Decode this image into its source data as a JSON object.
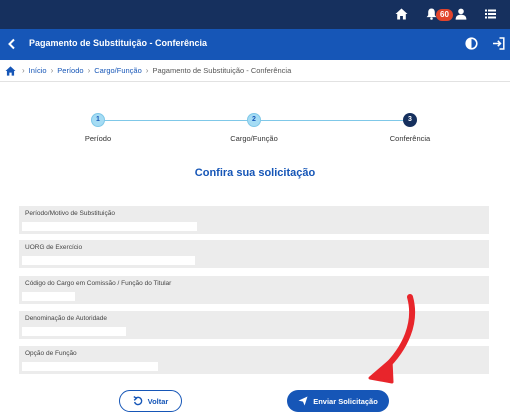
{
  "topbar": {
    "notifications_count": "60",
    "icons": [
      "home-icon",
      "bell-icon",
      "user-icon",
      "menu-icon"
    ]
  },
  "titlebar": {
    "title": "Pagamento de Substituição - Conferência"
  },
  "breadcrumb": {
    "items": [
      "Início",
      "Período",
      "Cargo/Função",
      "Pagamento de Substituição - Conferência"
    ]
  },
  "stepper": {
    "steps": [
      {
        "number": "1",
        "label": "Período",
        "state": "pending"
      },
      {
        "number": "2",
        "label": "Cargo/Função",
        "state": "pending"
      },
      {
        "number": "3",
        "label": "Conferência",
        "state": "active"
      }
    ]
  },
  "main": {
    "heading": "Confira sua solicitação",
    "fields": [
      {
        "label": "Período/Motivo de Substituição"
      },
      {
        "label": "UORG de Exercício"
      },
      {
        "label": "Código do Cargo em Comissão / Função do Titular"
      },
      {
        "label": "Denominação de Autoridade"
      },
      {
        "label": "Opção de Função"
      }
    ]
  },
  "actions": {
    "back_label": "Voltar",
    "submit_label": "Enviar Solicitação"
  },
  "colors": {
    "topbar": "#16305e",
    "titlebar": "#1656b7",
    "link": "#1656b7",
    "badge": "#e1442c",
    "annotation_arrow": "#e8252b"
  }
}
